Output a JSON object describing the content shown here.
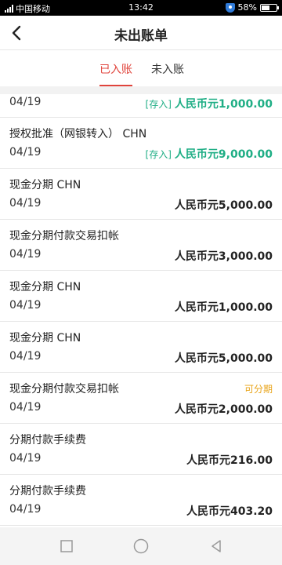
{
  "status_bar": {
    "carrier": "中国移动",
    "time": "13:42",
    "battery": "58%",
    "battery_level": 0.58
  },
  "header": {
    "title": "未出账单"
  },
  "tabs": [
    {
      "label": "已入账",
      "active": true
    },
    {
      "label": "未入账",
      "active": false
    }
  ],
  "transactions": [
    {
      "description": "",
      "date": "04/19",
      "tag": "[存入]",
      "amount": "人民币元1,000.00",
      "amount_color": "#1fae85"
    },
    {
      "description": "授权批准（网银转入） CHN",
      "date": "04/19",
      "tag": "[存入]",
      "amount": "人民币元9,000.00",
      "amount_color": "#1fae85"
    },
    {
      "description": "现金分期 CHN",
      "date": "04/19",
      "amount": "人民币元5,000.00"
    },
    {
      "description": "现金分期付款交易扣帐",
      "date": "04/19",
      "amount": "人民币元3,000.00"
    },
    {
      "description": "现金分期 CHN",
      "date": "04/19",
      "amount": "人民币元1,000.00"
    },
    {
      "description": "现金分期 CHN",
      "date": "04/19",
      "amount": "人民币元5,000.00"
    },
    {
      "description": "现金分期付款交易扣帐",
      "date": "04/19",
      "flag": "可分期",
      "flag_color": "#e8a317",
      "amount": "人民币元2,000.00"
    },
    {
      "description": "分期付款手续费",
      "date": "04/19",
      "amount": "人民币元216.00"
    },
    {
      "description": "分期付款手续费",
      "date": "04/19",
      "amount": "人民币元403.20"
    }
  ],
  "system_nav": {
    "icons": [
      "square-icon",
      "circle-icon",
      "triangle-back-icon"
    ]
  }
}
